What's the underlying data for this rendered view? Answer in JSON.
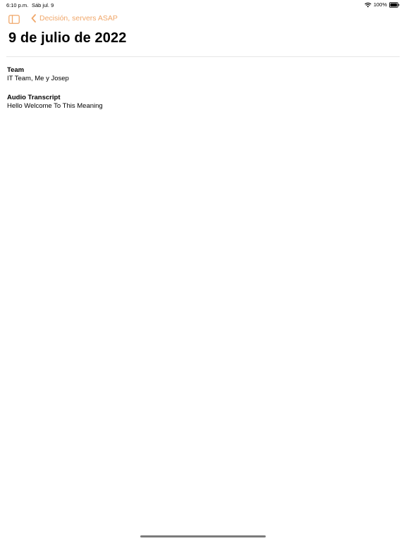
{
  "status_bar": {
    "time": "6:10 p.m.",
    "date": "Sáb jul. 9",
    "battery": "100%",
    "icons": [
      "wifi-icon",
      "battery-icon"
    ]
  },
  "nav": {
    "sidebar_icon": "sidebar-toggle-icon",
    "back_label": "Decisión, servers ASAP",
    "back_icon": "chevron-left-icon",
    "accent_color": "#f0a76a"
  },
  "page": {
    "title": "9 de julio de 2022"
  },
  "sections": {
    "team": {
      "label": "Team",
      "value": "IT Team, Me y Josep"
    },
    "audio": {
      "label": "Audio Transcript",
      "value": "Hello Welcome To This Meaning"
    }
  }
}
